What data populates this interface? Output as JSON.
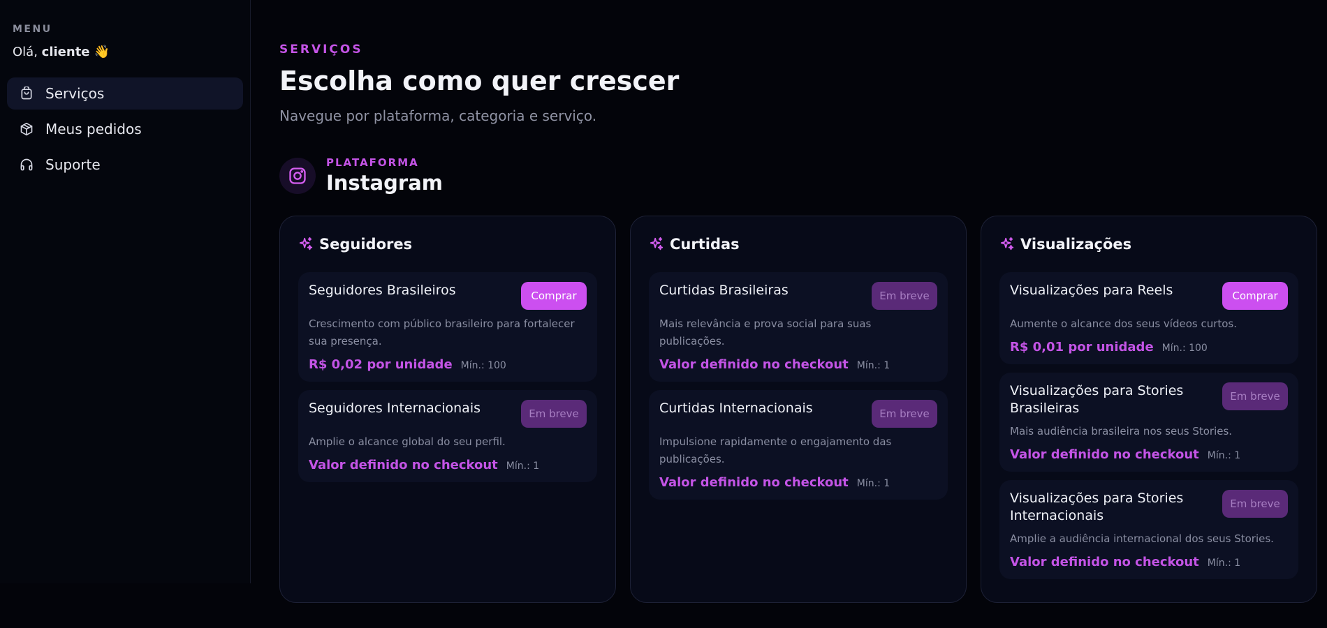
{
  "sidebar": {
    "menu_label": "MENU",
    "greeting_prefix": "Olá,",
    "greeting_name": "cliente 👋",
    "items": [
      {
        "label": "Serviços",
        "icon": "shopping-bag-icon",
        "active": true
      },
      {
        "label": "Meus pedidos",
        "icon": "package-icon",
        "active": false
      },
      {
        "label": "Suporte",
        "icon": "headphones-icon",
        "active": false
      }
    ]
  },
  "header": {
    "eyebrow": "SERVIÇOS",
    "title": "Escolha como quer crescer",
    "subtitle": "Navegue por plataforma, categoria e serviço."
  },
  "platform": {
    "eyebrow": "PLATAFORMA",
    "name": "Instagram",
    "icon": "instagram-icon"
  },
  "colors": {
    "accent": "#c454e6",
    "button_active": "#cc4ff0",
    "button_disabled": "#5a2a78",
    "background": "#03040a",
    "card": "#070a18"
  },
  "categories": [
    {
      "title": "Seguidores",
      "icon": "sparkles-icon",
      "services": [
        {
          "name": "Seguidores Brasileiros",
          "button": "Comprar",
          "available": true,
          "description": "Crescimento com público brasileiro para fortalecer sua presença.",
          "price": "R$ 0,02 por unidade",
          "min": "Mín.: 100"
        },
        {
          "name": "Seguidores Internacionais",
          "button": "Em breve",
          "available": false,
          "description": "Amplie o alcance global do seu perfil.",
          "price": "Valor definido no checkout",
          "min": "Mín.: 1"
        }
      ]
    },
    {
      "title": "Curtidas",
      "icon": "sparkles-icon",
      "services": [
        {
          "name": "Curtidas Brasileiras",
          "button": "Em breve",
          "available": false,
          "description": "Mais relevância e prova social para suas publicações.",
          "price": "Valor definido no checkout",
          "min": "Mín.: 1"
        },
        {
          "name": "Curtidas Internacionais",
          "button": "Em breve",
          "available": false,
          "description": "Impulsione rapidamente o engajamento das publicações.",
          "price": "Valor definido no checkout",
          "min": "Mín.: 1"
        }
      ]
    },
    {
      "title": "Visualizações",
      "icon": "sparkles-icon",
      "services": [
        {
          "name": "Visualizações para Reels",
          "button": "Comprar",
          "available": true,
          "description": "Aumente o alcance dos seus vídeos curtos.",
          "price": "R$ 0,01 por unidade",
          "min": "Mín.: 100"
        },
        {
          "name": "Visualizações para Stories Brasileiras",
          "button": "Em breve",
          "available": false,
          "description": "Mais audiência brasileira nos seus Stories.",
          "price": "Valor definido no checkout",
          "min": "Mín.: 1"
        },
        {
          "name": "Visualizações para Stories Internacionais",
          "button": "Em breve",
          "available": false,
          "description": "Amplie a audiência internacional dos seus Stories.",
          "price": "Valor definido no checkout",
          "min": "Mín.: 1"
        }
      ]
    }
  ]
}
